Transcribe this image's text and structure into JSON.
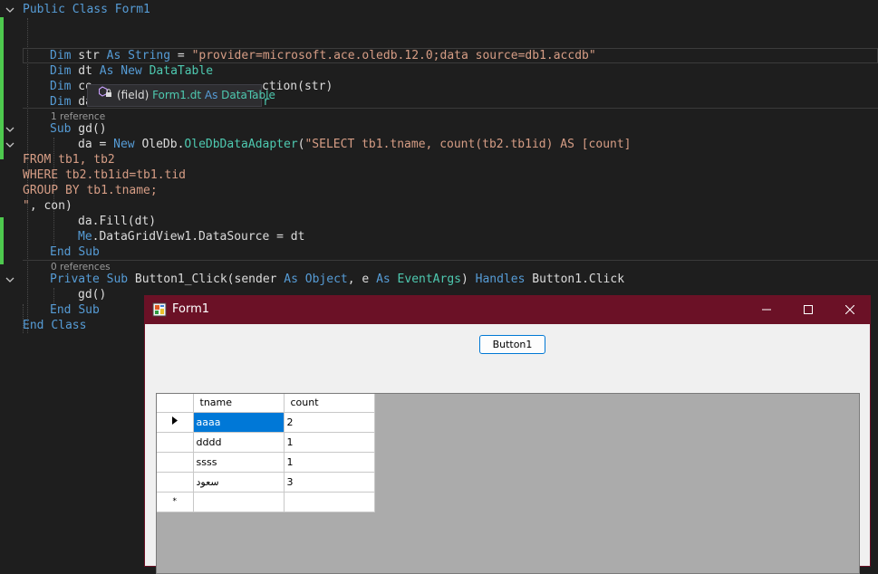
{
  "editor": {
    "lines": {
      "l1": "Public Class Form1",
      "l2a": "Dim",
      "l2b": " str ",
      "l2c": "As",
      "l2d": " ",
      "l2e": "String",
      "l2f": " = ",
      "l2g": "\"provider=microsoft.ace.oledb.12.0;data source=db1.accdb\"",
      "l3a": "Dim",
      "l3b": " dt ",
      "l3c": "As",
      "l3d": " ",
      "l3e": "New",
      "l3f": " ",
      "l3g": "DataTable",
      "l4a": "Dim",
      "l4b": " co",
      "l4c": "ction(str)",
      "l5a": "Dim",
      "l5b": " da",
      "l5c": "r",
      "ref1": "1 reference",
      "l6a": "Sub",
      "l6b": " gd()",
      "l7a": "da = ",
      "l7b": "New",
      "l7c": " OleDb.",
      "l7d": "OleDbDataAdapter",
      "l7e": "(",
      "l7f": "\"SELECT tb1.tname, count(tb2.tb1id) AS [count]",
      "l8": "FROM tb1, tb2",
      "l9": "WHERE tb2.tb1id=tb1.tid",
      "l10": "GROUP BY tb1.tname;",
      "l11a": "\"",
      "l11b": ", con)",
      "l12": "da.Fill(dt)",
      "l13a": "Me",
      "l13b": ".DataGridView1.DataSource = dt",
      "l14a": "End",
      "l14b": " ",
      "l14c": "Sub",
      "ref0": "0 references",
      "l15a": "Private",
      "l15b": " ",
      "l15c": "Sub",
      "l15d": " Button1_Click(sender ",
      "l15e": "As",
      "l15f": " ",
      "l15g": "Object",
      "l15h": ", e ",
      "l15i": "As",
      "l15j": " ",
      "l15k": "EventArgs",
      "l15l": ") ",
      "l15m": "Handles",
      "l15n": " Button1.Click",
      "l16": "gd()",
      "l17a": "End",
      "l17b": " ",
      "l17c": "Sub",
      "l18a": "End",
      "l18b": " ",
      "l18c": "Class"
    },
    "tooltip": {
      "prefix": "(field) ",
      "name": "Form1.dt",
      "as": " As ",
      "type": "DataTable"
    }
  },
  "form": {
    "title": "Form1",
    "button_label": "Button1",
    "grid": {
      "columns": [
        "tname",
        "count"
      ],
      "rows": [
        {
          "tname": "aaaa",
          "count": "2"
        },
        {
          "tname": "dddd",
          "count": "1"
        },
        {
          "tname": "ssss",
          "count": "1"
        },
        {
          "tname": "سعود",
          "count": "3"
        }
      ],
      "new_row_marker": "*"
    }
  },
  "colors": {
    "titlebar": "#6b1126",
    "keyword": "#569cd6",
    "type": "#4ec9b0",
    "string": "#d69d85",
    "selection": "#0078d7"
  },
  "icons": [
    "fold-chevron-icon",
    "field-lock-icon",
    "app-icon",
    "minimize-icon",
    "maximize-icon",
    "close-icon",
    "row-pointer-icon"
  ]
}
